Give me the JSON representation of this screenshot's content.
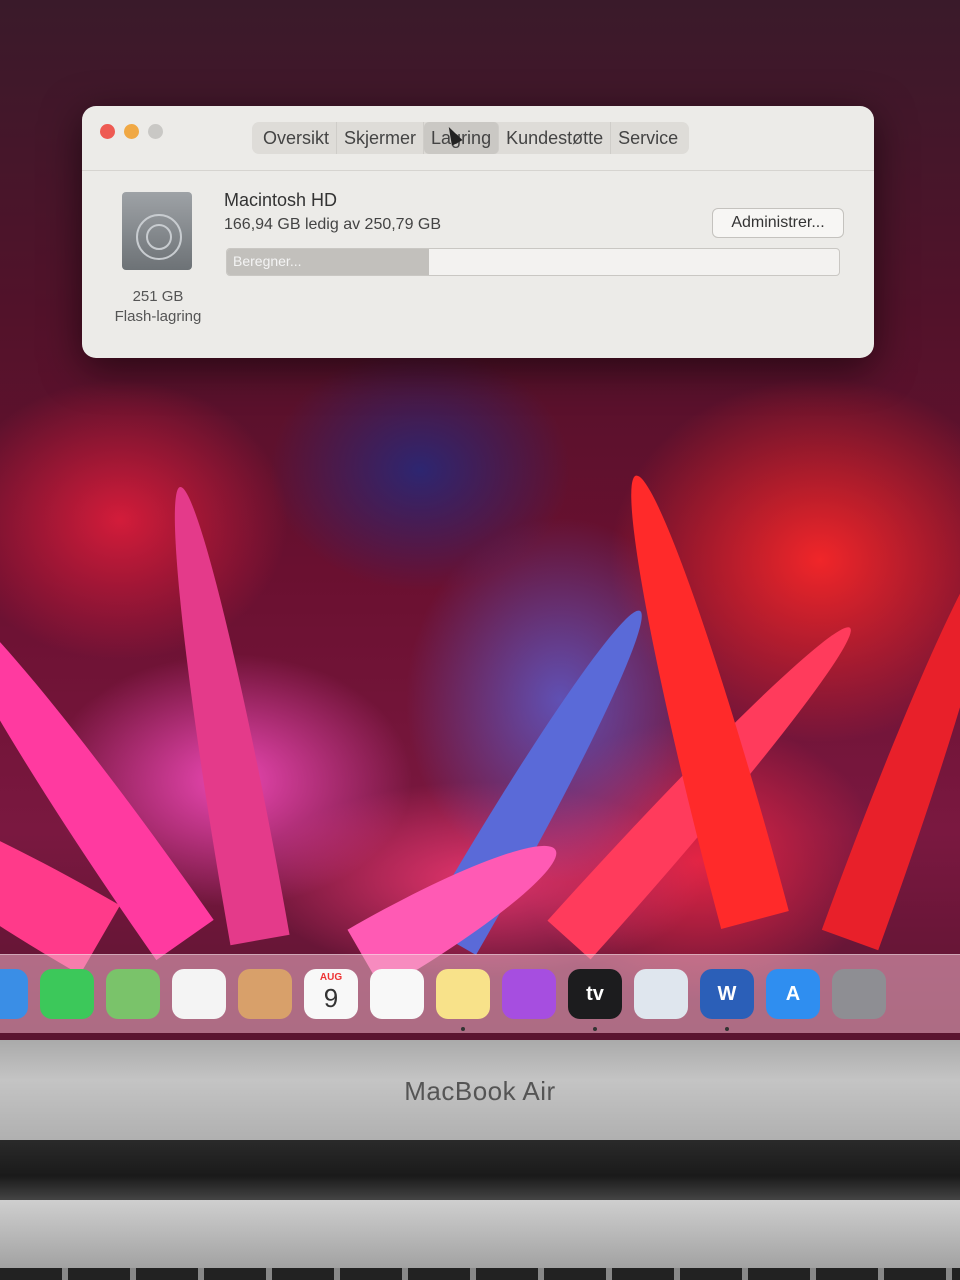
{
  "window": {
    "tabs": [
      {
        "label": "Oversikt",
        "active": false
      },
      {
        "label": "Skjermer",
        "active": false
      },
      {
        "label": "Lagring",
        "active": true
      },
      {
        "label": "Kundestøtte",
        "active": false
      },
      {
        "label": "Service",
        "active": false
      }
    ],
    "drive": {
      "icon": "hard-drive-icon",
      "capacity": "251 GB",
      "type": "Flash-lagring"
    },
    "disk": {
      "name": "Macintosh HD",
      "free_text": "166,94 GB ledig av 250,79 GB",
      "manage_label": "Administrer...",
      "bar_label": "Beregner...",
      "bar_fill_fraction": 0.33
    }
  },
  "dock": {
    "apps": [
      {
        "name": "mail",
        "color": "#3a8ee6",
        "label": "",
        "running": false
      },
      {
        "name": "facetime",
        "color": "#3cc85a",
        "label": "",
        "running": false
      },
      {
        "name": "maps",
        "color": "#7ac36a",
        "label": "",
        "running": false
      },
      {
        "name": "photos",
        "color": "#f4f4f4",
        "label": "",
        "running": false
      },
      {
        "name": "contacts",
        "color": "#d8a06a",
        "label": "",
        "running": false
      },
      {
        "name": "calendar",
        "color": "#f8f8f8",
        "label": "",
        "running": false
      },
      {
        "name": "reminders",
        "color": "#f8f8f8",
        "label": "",
        "running": false
      },
      {
        "name": "notes",
        "color": "#f8e28a",
        "label": "",
        "running": true
      },
      {
        "name": "podcasts",
        "color": "#a64ee0",
        "label": "",
        "running": false
      },
      {
        "name": "apple-tv",
        "color": "#1c1c1e",
        "label": "tv",
        "running": true
      },
      {
        "name": "preview",
        "color": "#dfe6ee",
        "label": "",
        "running": false
      },
      {
        "name": "word",
        "color": "#2b5fb8",
        "label": "W",
        "running": true
      },
      {
        "name": "app-store",
        "color": "#2f8ef0",
        "label": "A",
        "running": false
      },
      {
        "name": "system-preferences",
        "color": "#8e8e93",
        "label": "",
        "running": false
      }
    ],
    "calendar": {
      "month": "AUG",
      "day": "9"
    }
  },
  "laptop": {
    "brand": "MacBook Air"
  }
}
